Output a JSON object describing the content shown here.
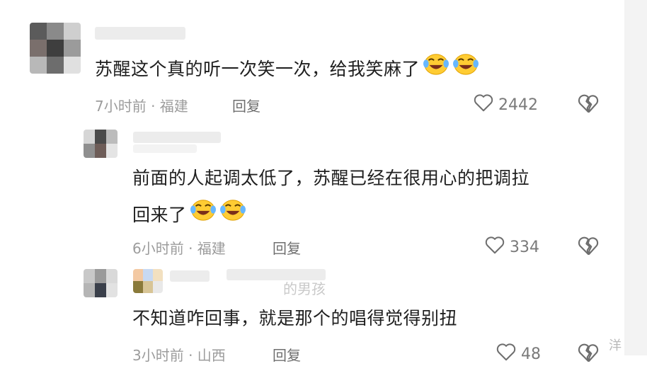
{
  "comments": [
    {
      "text": "苏醒这个真的听一次笑一次，给我笑麻了",
      "time_location": "7小时前 · 福建",
      "reply_label": "回复",
      "likes": "2442"
    },
    {
      "text_line1": "前面的人起调太低了，苏醒已经在很用心的把调拉",
      "text_line2": "回来了",
      "time_location": "6小时前 · 福建",
      "reply_label": "回复",
      "likes": "334"
    },
    {
      "tag_partial": "的男孩",
      "text": "不知道咋回事，就是那个的唱得觉得别扭",
      "time_location": "3小时前 · 山西",
      "reply_label": "回复",
      "likes": "48"
    }
  ],
  "watermark": "洋",
  "icons": {
    "like": "heart-outline-icon",
    "dislike": "broken-heart-icon",
    "emoji": "laughing-crying-emoji"
  }
}
